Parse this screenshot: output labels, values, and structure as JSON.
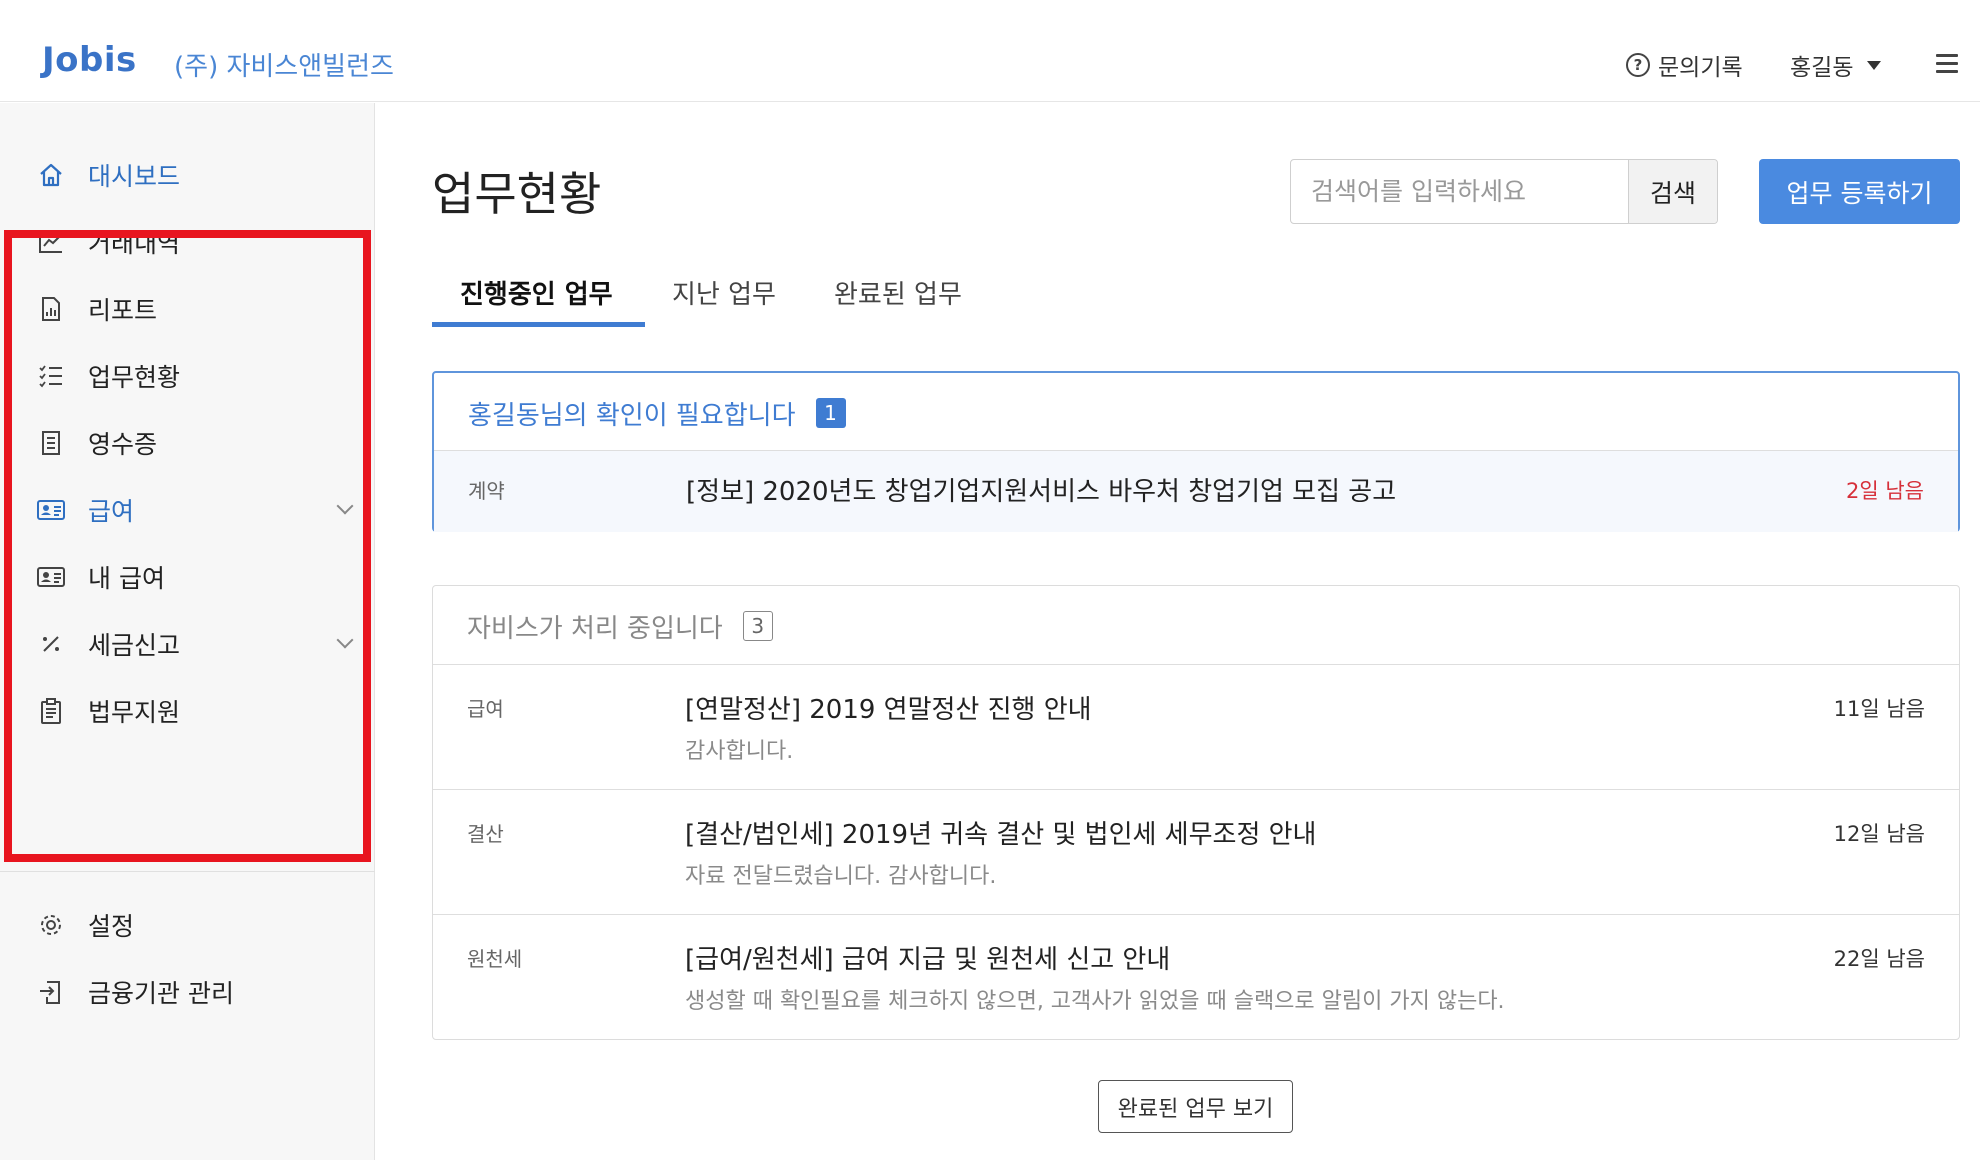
{
  "header": {
    "logo": "Jobis",
    "company": "(주) 자비스앤빌런즈",
    "help_label": "문의기록",
    "user_name": "홍길동"
  },
  "sidebar": {
    "items": [
      {
        "label": "대시보드",
        "icon": "home-icon",
        "active": true
      },
      {
        "label": "거래내역",
        "icon": "chart-line-icon"
      },
      {
        "label": "리포트",
        "icon": "report-icon"
      },
      {
        "label": "업무현황",
        "icon": "checklist-icon"
      },
      {
        "label": "영수증",
        "icon": "receipt-icon"
      },
      {
        "label": "급여",
        "icon": "id-card-icon",
        "active": true,
        "expandable": true
      },
      {
        "label": "내 급여",
        "icon": "id-card-icon"
      },
      {
        "label": "세금신고",
        "icon": "percent-icon",
        "expandable": true
      },
      {
        "label": "법무지원",
        "icon": "clipboard-icon"
      }
    ],
    "bottom_items": [
      {
        "label": "설정",
        "icon": "gear-icon"
      },
      {
        "label": "금융기관 관리",
        "icon": "bank-transfer-icon"
      }
    ]
  },
  "main": {
    "title": "업무현황",
    "search": {
      "placeholder": "검색어를 입력하세요",
      "button": "검색"
    },
    "register_button": "업무 등록하기",
    "tabs": [
      "진행중인 업무",
      "지난 업무",
      "완료된 업무"
    ],
    "needs_confirm": {
      "heading": "홍길동님의 확인이 필요합니다",
      "count": "1",
      "tasks": [
        {
          "category": "계약",
          "title": "[정보] 2020년도 창업기업지원서비스 바우처 창업기업 모집 공고",
          "due": "2일 남음"
        }
      ]
    },
    "processing": {
      "heading": "자비스가 처리 중입니다",
      "count": "3",
      "tasks": [
        {
          "category": "급여",
          "title": "[연말정산] 2019 연말정산 진행 안내",
          "subtitle": "감사합니다.",
          "due": "11일 남음"
        },
        {
          "category": "결산",
          "title": "[결산/법인세] 2019년 귀속 결산 및 법인세 세무조정 안내",
          "subtitle": "자료 전달드렸습니다. 감사합니다.",
          "due": "12일 남음"
        },
        {
          "category": "원천세",
          "title": "[급여/원천세] 급여 지급 및 원천세 신고 안내",
          "subtitle": "생성할 때 확인필요를 체크하지 않으면, 고객사가 읽었을 때 슬랙으로 알림이 가지 않는다.",
          "due": "22일 남음"
        }
      ]
    },
    "more_button": "완료된 업무 보기"
  },
  "colors": {
    "accent": "#3f7cd2",
    "primary_button": "#4a8ae0",
    "urgent": "#d6303a",
    "highlight_box": "#e8151f"
  }
}
